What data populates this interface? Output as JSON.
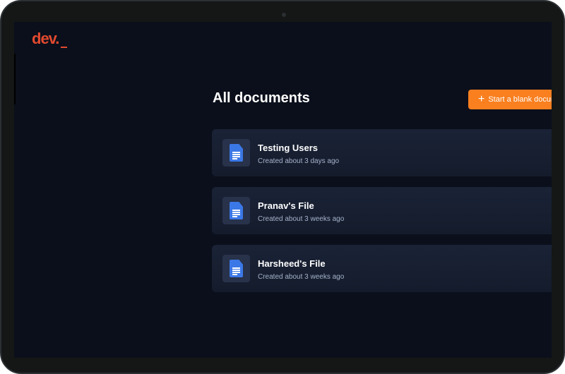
{
  "logo": "dev.",
  "header": {
    "title": "All documents",
    "new_button": "Start a blank document",
    "new_icon": "plus-icon"
  },
  "documents": [
    {
      "name": "Testing Users",
      "created": "Created about 3 days ago",
      "icon": "document-icon"
    },
    {
      "name": "Pranav's File",
      "created": "Created about 3 weeks ago",
      "icon": "document-icon"
    },
    {
      "name": "Harsheed's File",
      "created": "Created about 3 weeks ago",
      "icon": "document-icon"
    }
  ],
  "colors": {
    "accent": "#f97f1f",
    "logo": "#e2492f",
    "background": "#0a0f1b",
    "doc_icon": "#3b78e7"
  }
}
